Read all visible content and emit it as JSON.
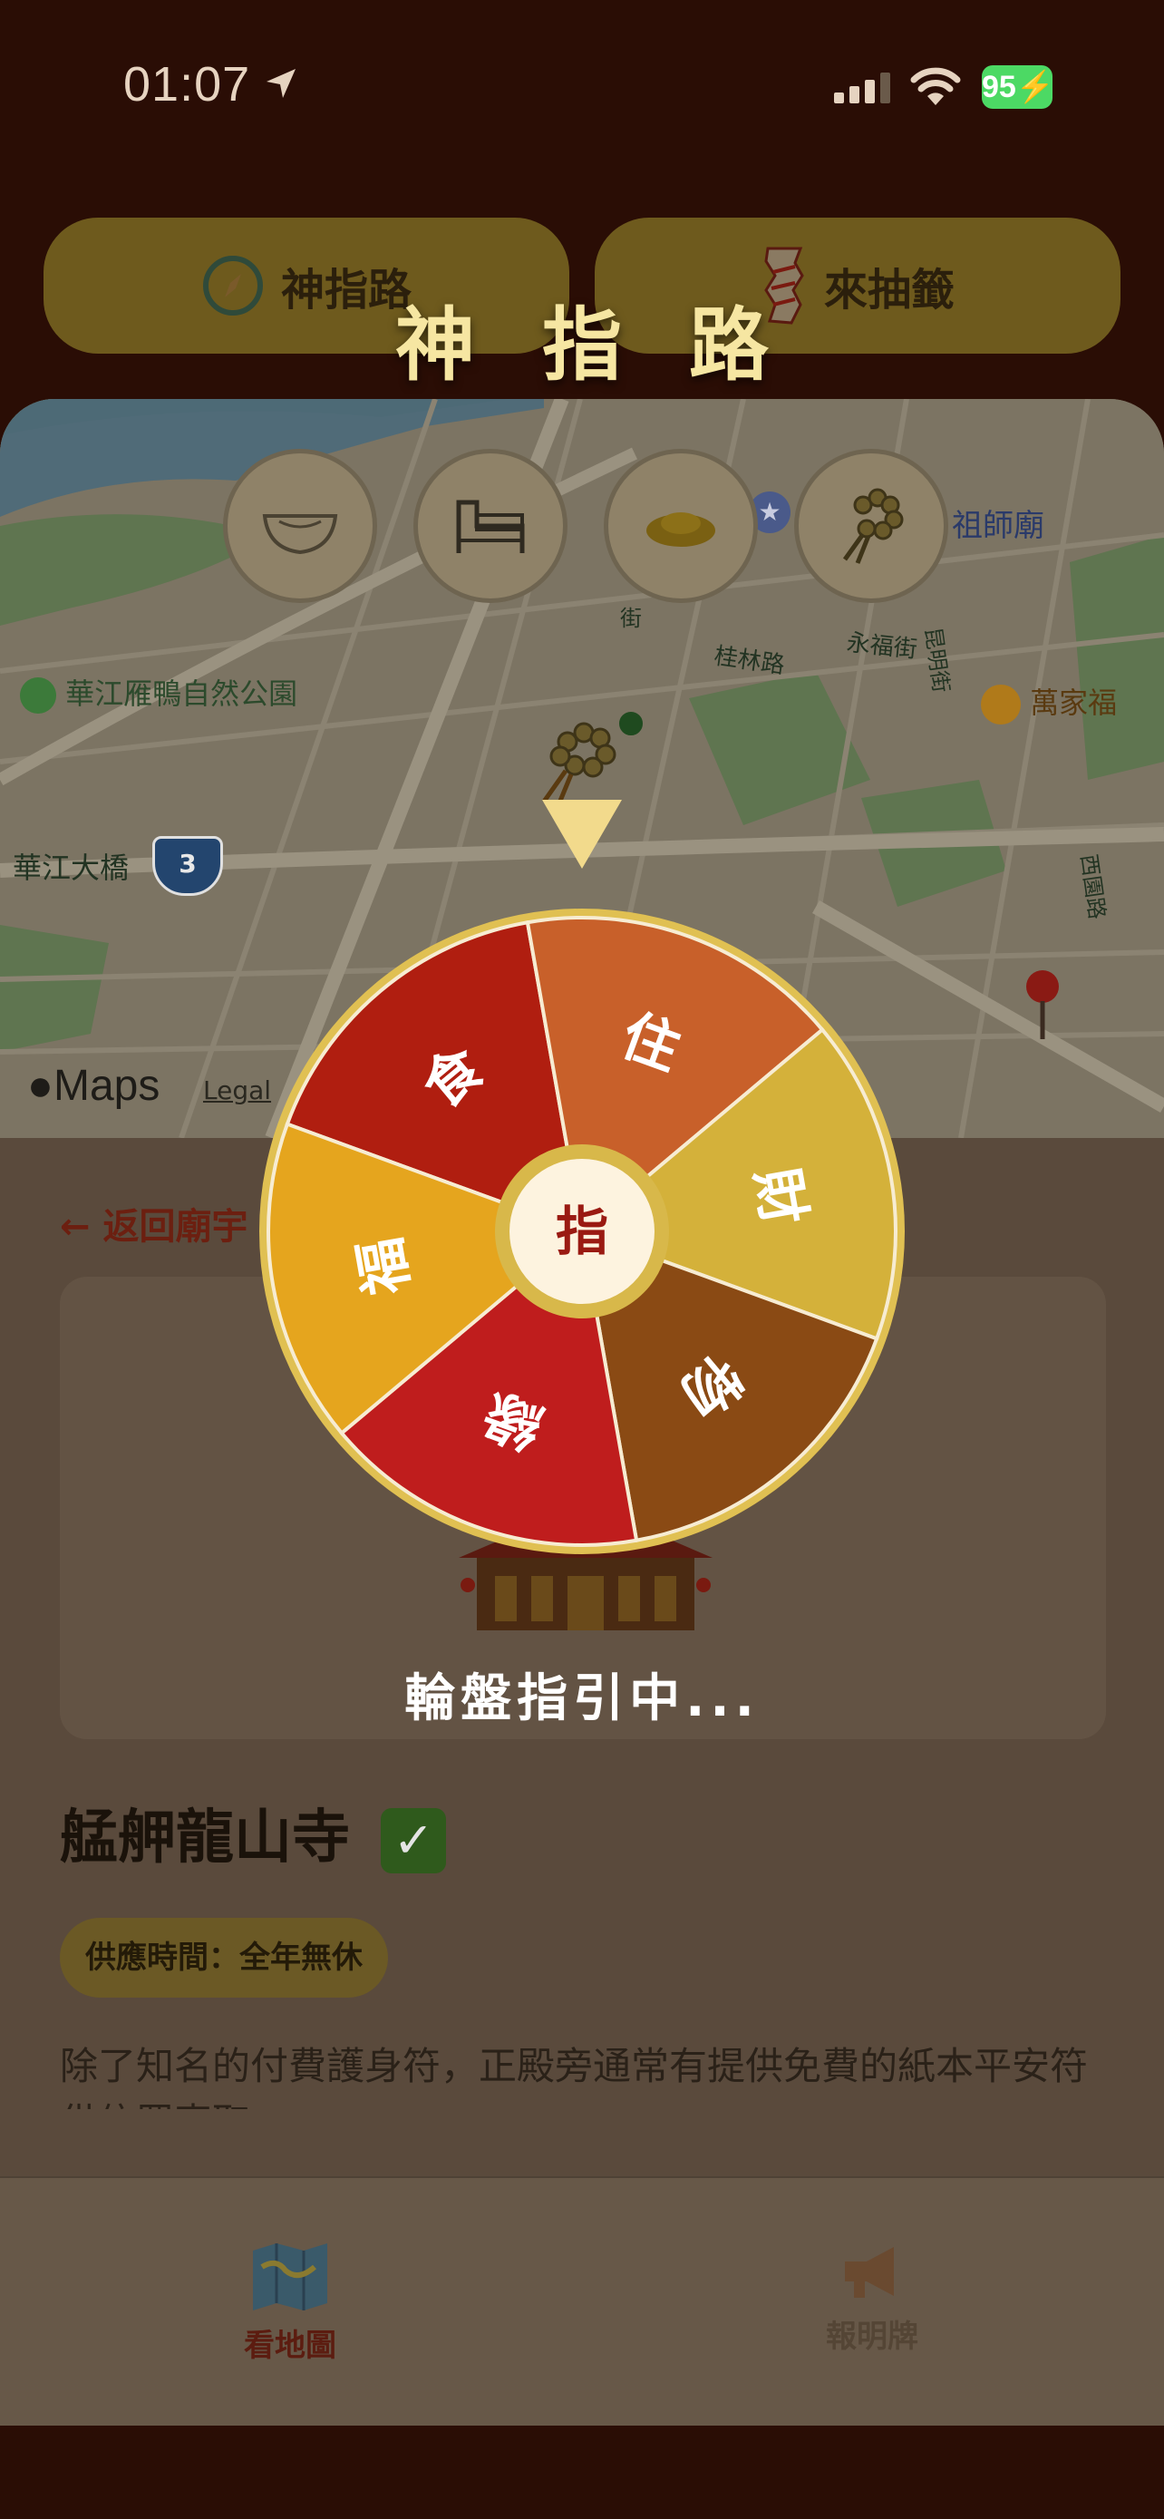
{
  "status_bar": {
    "time": "01:07",
    "battery": "95"
  },
  "top_buttons": {
    "shenzhilu": "神指路",
    "chouqian": "來抽籤"
  },
  "overlay_title": "神指路",
  "map": {
    "labels": {
      "park": "華江雁鴨自然公園",
      "bridge": "華江大橋",
      "route": "3",
      "temple": "祖師廟",
      "store": "萬家福",
      "street_guilin": "桂林路",
      "street_yongfu": "永福街",
      "street_kunming": "昆明街",
      "street_vertical": "街",
      "street_xiyuan": "西園路",
      "maps_brand": "Maps",
      "legal": "Legal"
    }
  },
  "categories": [
    "bowl-icon",
    "bed-icon",
    "gold-ingot-icon",
    "prayer-beads-icon"
  ],
  "wheel": {
    "center_label": "指",
    "segments": [
      {
        "label": "食",
        "color": "#b01e10"
      },
      {
        "label": "住",
        "color": "#c8602a"
      },
      {
        "label": "財",
        "color": "#d4b13a"
      },
      {
        "label": "物",
        "color": "#8a4a14"
      },
      {
        "label": "緣",
        "color": "#bf1d1d"
      },
      {
        "label": "福",
        "color": "#e5a51e"
      }
    ],
    "rim_color": "#e0c052",
    "status": "輪盤指引中..."
  },
  "detail": {
    "back_label": "返回廟宇",
    "temple_name": "艋舺龍山寺",
    "hours": "供應時間：全年無休",
    "description": "除了知名的付費護身符，正殿旁通常有提供免費的紙本平安符供信眾索取。"
  },
  "tabs": {
    "map": "看地圖",
    "report": "報明牌"
  }
}
